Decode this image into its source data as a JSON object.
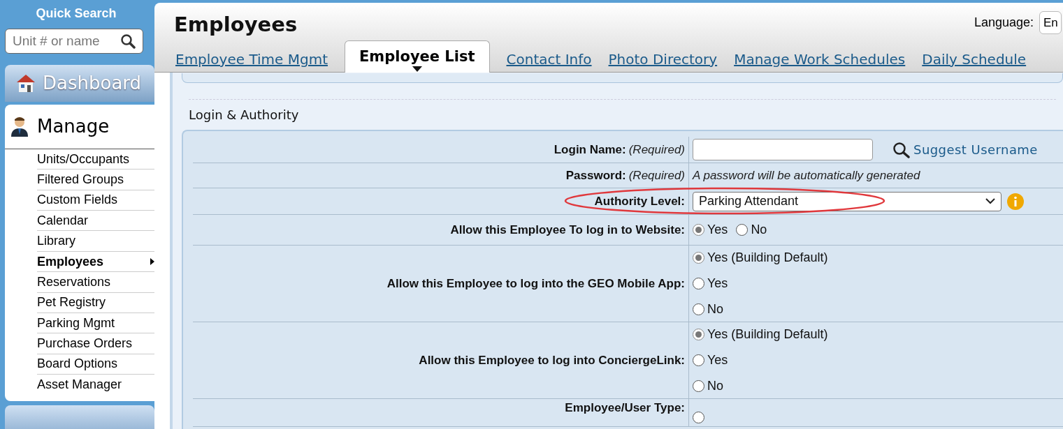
{
  "sidebar": {
    "quick_search": {
      "title": "Quick Search",
      "placeholder": "Unit # or name"
    },
    "dashboard": "Dashboard",
    "manage": {
      "title": "Manage",
      "items": [
        {
          "label": "Units/Occupants",
          "selected": false
        },
        {
          "label": "Filtered Groups",
          "selected": false
        },
        {
          "label": "Custom Fields",
          "selected": false
        },
        {
          "label": "Calendar",
          "selected": false
        },
        {
          "label": "Library",
          "selected": false
        },
        {
          "label": "Employees",
          "selected": true
        },
        {
          "label": "Reservations",
          "selected": false
        },
        {
          "label": "Pet Registry",
          "selected": false
        },
        {
          "label": "Parking Mgmt",
          "selected": false
        },
        {
          "label": "Purchase Orders",
          "selected": false
        },
        {
          "label": "Board Options",
          "selected": false
        },
        {
          "label": "Asset Manager",
          "selected": false
        }
      ]
    }
  },
  "header": {
    "title": "Employees",
    "language_label": "Language:",
    "language_value": "En"
  },
  "tabs": [
    {
      "label": "Employee Time Mgmt",
      "selected": false
    },
    {
      "label": "Employee List",
      "selected": true
    },
    {
      "label": "Contact Info",
      "selected": false
    },
    {
      "label": "Photo Directory",
      "selected": false
    },
    {
      "label": "Manage Work Schedules",
      "selected": false
    },
    {
      "label": "Daily Schedule",
      "selected": false
    }
  ],
  "section": {
    "title": "Login & Authority",
    "rows": [
      {
        "kind": "input",
        "label": "Login Name:",
        "note": "(Required)",
        "link": "Suggest Username"
      },
      {
        "kind": "text",
        "label": "Password:",
        "note": "(Required)",
        "value": "A password will be automatically generated"
      },
      {
        "kind": "select",
        "label": "Authority Level:",
        "value": "Parking Attendant",
        "highlighted": true
      },
      {
        "kind": "inline_radio",
        "label": "Allow this Employee To log in to Website:",
        "options": [
          {
            "label": "Yes",
            "selected": true
          },
          {
            "label": "No",
            "selected": false
          }
        ]
      },
      {
        "kind": "radio",
        "label": "Allow this Employee to log into the GEO Mobile App:",
        "options": [
          {
            "label": "Yes (Building Default)",
            "selected": true
          },
          {
            "label": "Yes",
            "selected": false
          },
          {
            "label": "No",
            "selected": false
          }
        ]
      },
      {
        "kind": "radio",
        "label": "Allow this Employee to log into ConciergeLink:",
        "options": [
          {
            "label": "Yes (Building Default)",
            "selected": true
          },
          {
            "label": "Yes",
            "selected": false
          },
          {
            "label": "No",
            "selected": false
          }
        ]
      },
      {
        "kind": "partial",
        "label": "Employee/User Type:",
        "options": [
          {
            "selected": false
          }
        ]
      }
    ]
  }
}
